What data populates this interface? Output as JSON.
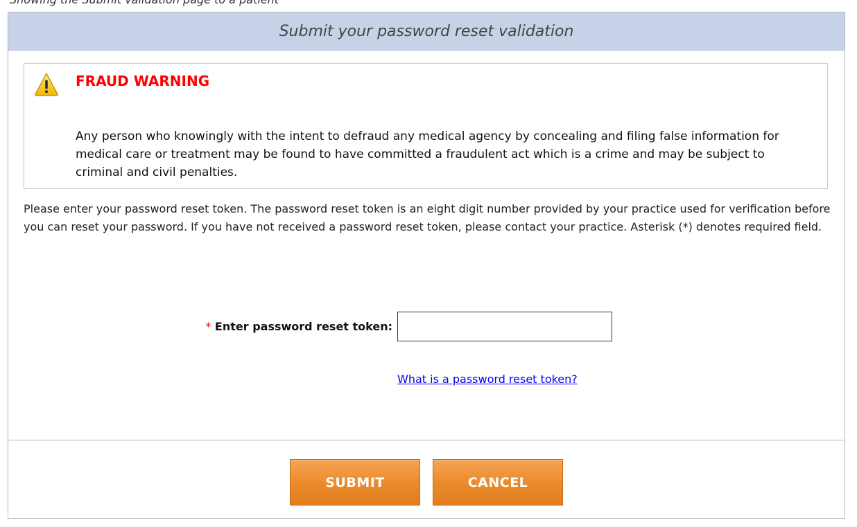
{
  "top_text": "Showing the Submit validation page to a patient",
  "panel": {
    "title": "Submit your password reset validation"
  },
  "warning": {
    "icon": "warning-triangle-icon",
    "title": "FRAUD WARNING",
    "text": "Any person who knowingly with the intent to defraud any medical agency by concealing and filing false information for medical care or treatment may be found to have committed a fraudulent act which is a crime and may be subject to criminal and civil penalties."
  },
  "instructions": "Please enter your password reset token. The password reset token is an eight digit number provided by your practice used for verification before you can reset your password. If you have not received a password reset token, please contact your practice. Asterisk (*) denotes required field.",
  "form": {
    "required_marker": "*",
    "token_label": "Enter password reset token:",
    "token_value": "",
    "help_link": "What is a password reset token?"
  },
  "buttons": {
    "submit": "SUBMIT",
    "cancel": "CANCEL"
  },
  "colors": {
    "header_bg": "#c7d2e8",
    "warning_title": "#ff0000",
    "button_orange": "#e98a2a",
    "link": "#0000ee"
  }
}
